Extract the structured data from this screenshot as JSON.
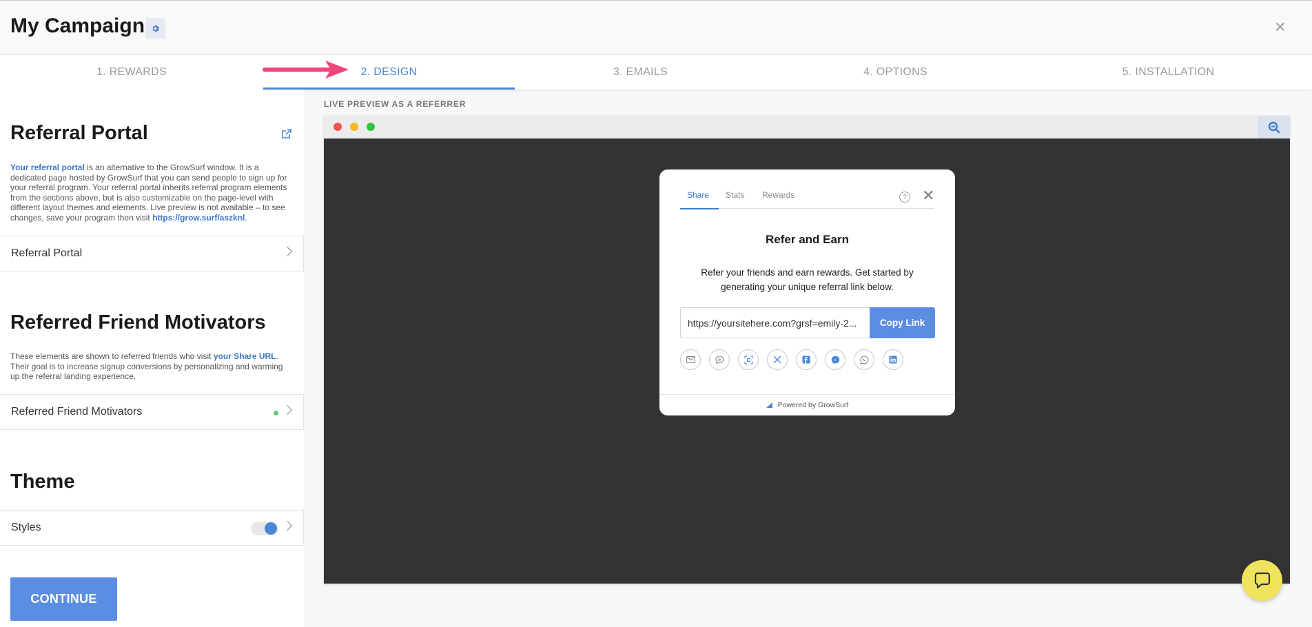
{
  "header": {
    "title": "My Campaign",
    "close_symbol": "×",
    "gear_icon": "gear-icon"
  },
  "tabs": [
    {
      "label": "1. REWARDS"
    },
    {
      "label": "2. DESIGN"
    },
    {
      "label": "3. EMAILS"
    },
    {
      "label": "4. OPTIONS"
    },
    {
      "label": "5. INSTALLATION"
    }
  ],
  "active_tab": "2. DESIGN",
  "left": {
    "portal": {
      "title": "Referral Portal",
      "desc_link": "Your referral portal",
      "desc_text": " is an alternative to the GrowSurf window. It is a dedicated page hosted by GrowSurf that you can send people to sign up for your referral program. Your referral portal inherits referral program elements from the sections above, but is also customizable on the page-level with different layout themes and elements. Live preview is not available – to see changes, save your program then visit ",
      "desc_url": "https://grow.surf/aszknl",
      "desc_end": ".",
      "row_label": "Referral Portal"
    },
    "motivators": {
      "title": "Referred Friend Motivators",
      "desc_text": "These elements are shown to referred friends who visit ",
      "desc_link": "your Share URL",
      "desc_rest": ". Their goal is to increase signup conversions by personalizing and warming up the referral landing experience.",
      "row_label": "Referred Friend Motivators"
    },
    "theme": {
      "title": "Theme",
      "row_label": "Styles"
    },
    "continue_label": "CONTINUE"
  },
  "preview": {
    "label": "LIVE PREVIEW AS A REFERRER",
    "widget": {
      "tabs": [
        "Share",
        "Stats",
        "Rewards"
      ],
      "title": "Refer and Earn",
      "description": "Refer your friends and earn rewards. Get started by generating your unique referral link below.",
      "link": "https://yoursitehere.com?grsf=emily-2...",
      "copy_label": "Copy Link",
      "share_icons": [
        "email-icon",
        "sms-icon",
        "qr-code-icon",
        "x-icon",
        "facebook-icon",
        "messenger-icon",
        "whatsapp-icon",
        "linkedin-icon"
      ],
      "footer": "Powered by GrowSurf"
    }
  },
  "colors": {
    "accent": "#4a86d6",
    "button": "#5b8ee3",
    "arrow": "#f0457a",
    "chat": "#f0e35c"
  }
}
